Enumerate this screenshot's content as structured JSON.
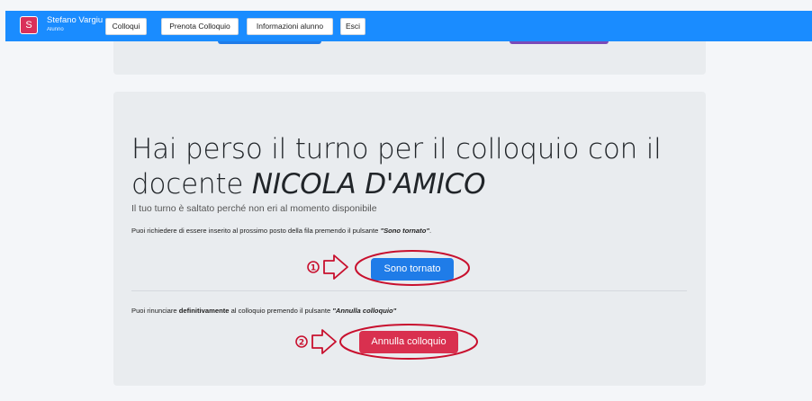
{
  "navbar": {
    "avatar_letter": "S",
    "user_name": "Stefano Vargiu",
    "user_role": "Alunno",
    "buttons": [
      "Colloqui",
      "Prenota Colloquio",
      "Informazioni alunno",
      "Esci"
    ]
  },
  "card": {
    "headline_part1": "Hai perso il turno per il colloquio con il docente ",
    "teacher": "NICOLA D'AMICO",
    "lead": "Il tuo turno è saltato perché non eri al momento disponibile",
    "p1_text": "Puoi richiedere di essere inserito al prossimo posto della fila premendo il pulsante ",
    "p1_em": "\"Sono tornato\"",
    "p1_end": ".",
    "rejoin_button": "Sono tornato",
    "p2_text1": "Puoi rinunciare ",
    "p2_strong": "definitivamente",
    "p2_text2": " al colloquio premendo il pulsante ",
    "p2_em": "\"Annulla colloquio\"",
    "cancel_button": "Annulla colloquio"
  },
  "annotations": {
    "step1": "1",
    "step2": "2",
    "color": "#c8102e"
  },
  "colors": {
    "navbar": "#1a8cff",
    "primary": "#1f7ce8",
    "danger": "#d9304f",
    "card": "#e9ecef"
  }
}
